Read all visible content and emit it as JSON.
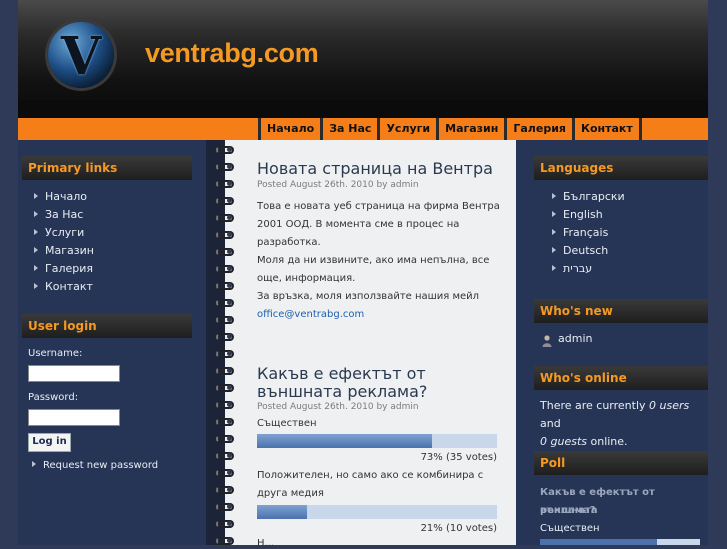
{
  "header": {
    "logo_letter": "V",
    "site_name": "ventrabg.com"
  },
  "nav": [
    "Начало",
    "За Нас",
    "Услуги",
    "Магазин",
    "Галерия",
    "Контакт"
  ],
  "primary_links": {
    "title": "Primary links",
    "items": [
      "Начало",
      "За Нас",
      "Услуги",
      "Магазин",
      "Галерия",
      "Контакт"
    ]
  },
  "user_login": {
    "title": "User login",
    "username_label": "Username:",
    "password_label": "Password:",
    "login_button": "Log in",
    "request_password": "Request new password"
  },
  "article1": {
    "title": "Новата страница на Вентра",
    "submitted": "Posted August 26th. 2010 by admin",
    "lines": [
      "Това е новата уеб страница на фирма Вентра",
      "2001 ООД. В момента сме в процес на",
      "разработка.",
      "Моля да ни извините, ако има непълна, все",
      "още, информация.",
      "За връзка, моля използвайте нашия мейл"
    ],
    "email": "office@ventrabg.com"
  },
  "article2": {
    "title_line1": "Какъв е ефектът от",
    "title_line2": "външната реклама?",
    "submitted": "Posted August 26th. 2010 by admin",
    "choices": [
      {
        "text_line1": "Съществен",
        "text_line2": "",
        "percent": 73,
        "caption": "73% (35 votes)"
      },
      {
        "text_line1": "Положителен, но само ако се комбинира с",
        "text_line2": "друга медия",
        "percent": 21,
        "caption": "21% (10 votes)"
      }
    ],
    "cutoff_text": "Н..."
  },
  "languages": {
    "title": "Languages",
    "items": [
      "Български",
      "English",
      "Français",
      "Deutsch",
      "עברית"
    ]
  },
  "whos_new": {
    "title": "Who's new",
    "user": "admin"
  },
  "whos_online": {
    "title": "Who's online",
    "line1_pre": "There are currently ",
    "line1_em": "0 users",
    "line1_post": " and",
    "line2_em": "0 guests",
    "line2_post": " online."
  },
  "poll": {
    "title": "Poll",
    "question_line1": "Какъв е ефектът от външната",
    "question_line2": "реклама?",
    "first_choice": "Съществен"
  },
  "colors": {
    "accent_orange": "#f57e18",
    "title_orange": "#f49a24",
    "sidebar_blue": "#263556",
    "bar_blue": "#4b72ad"
  }
}
